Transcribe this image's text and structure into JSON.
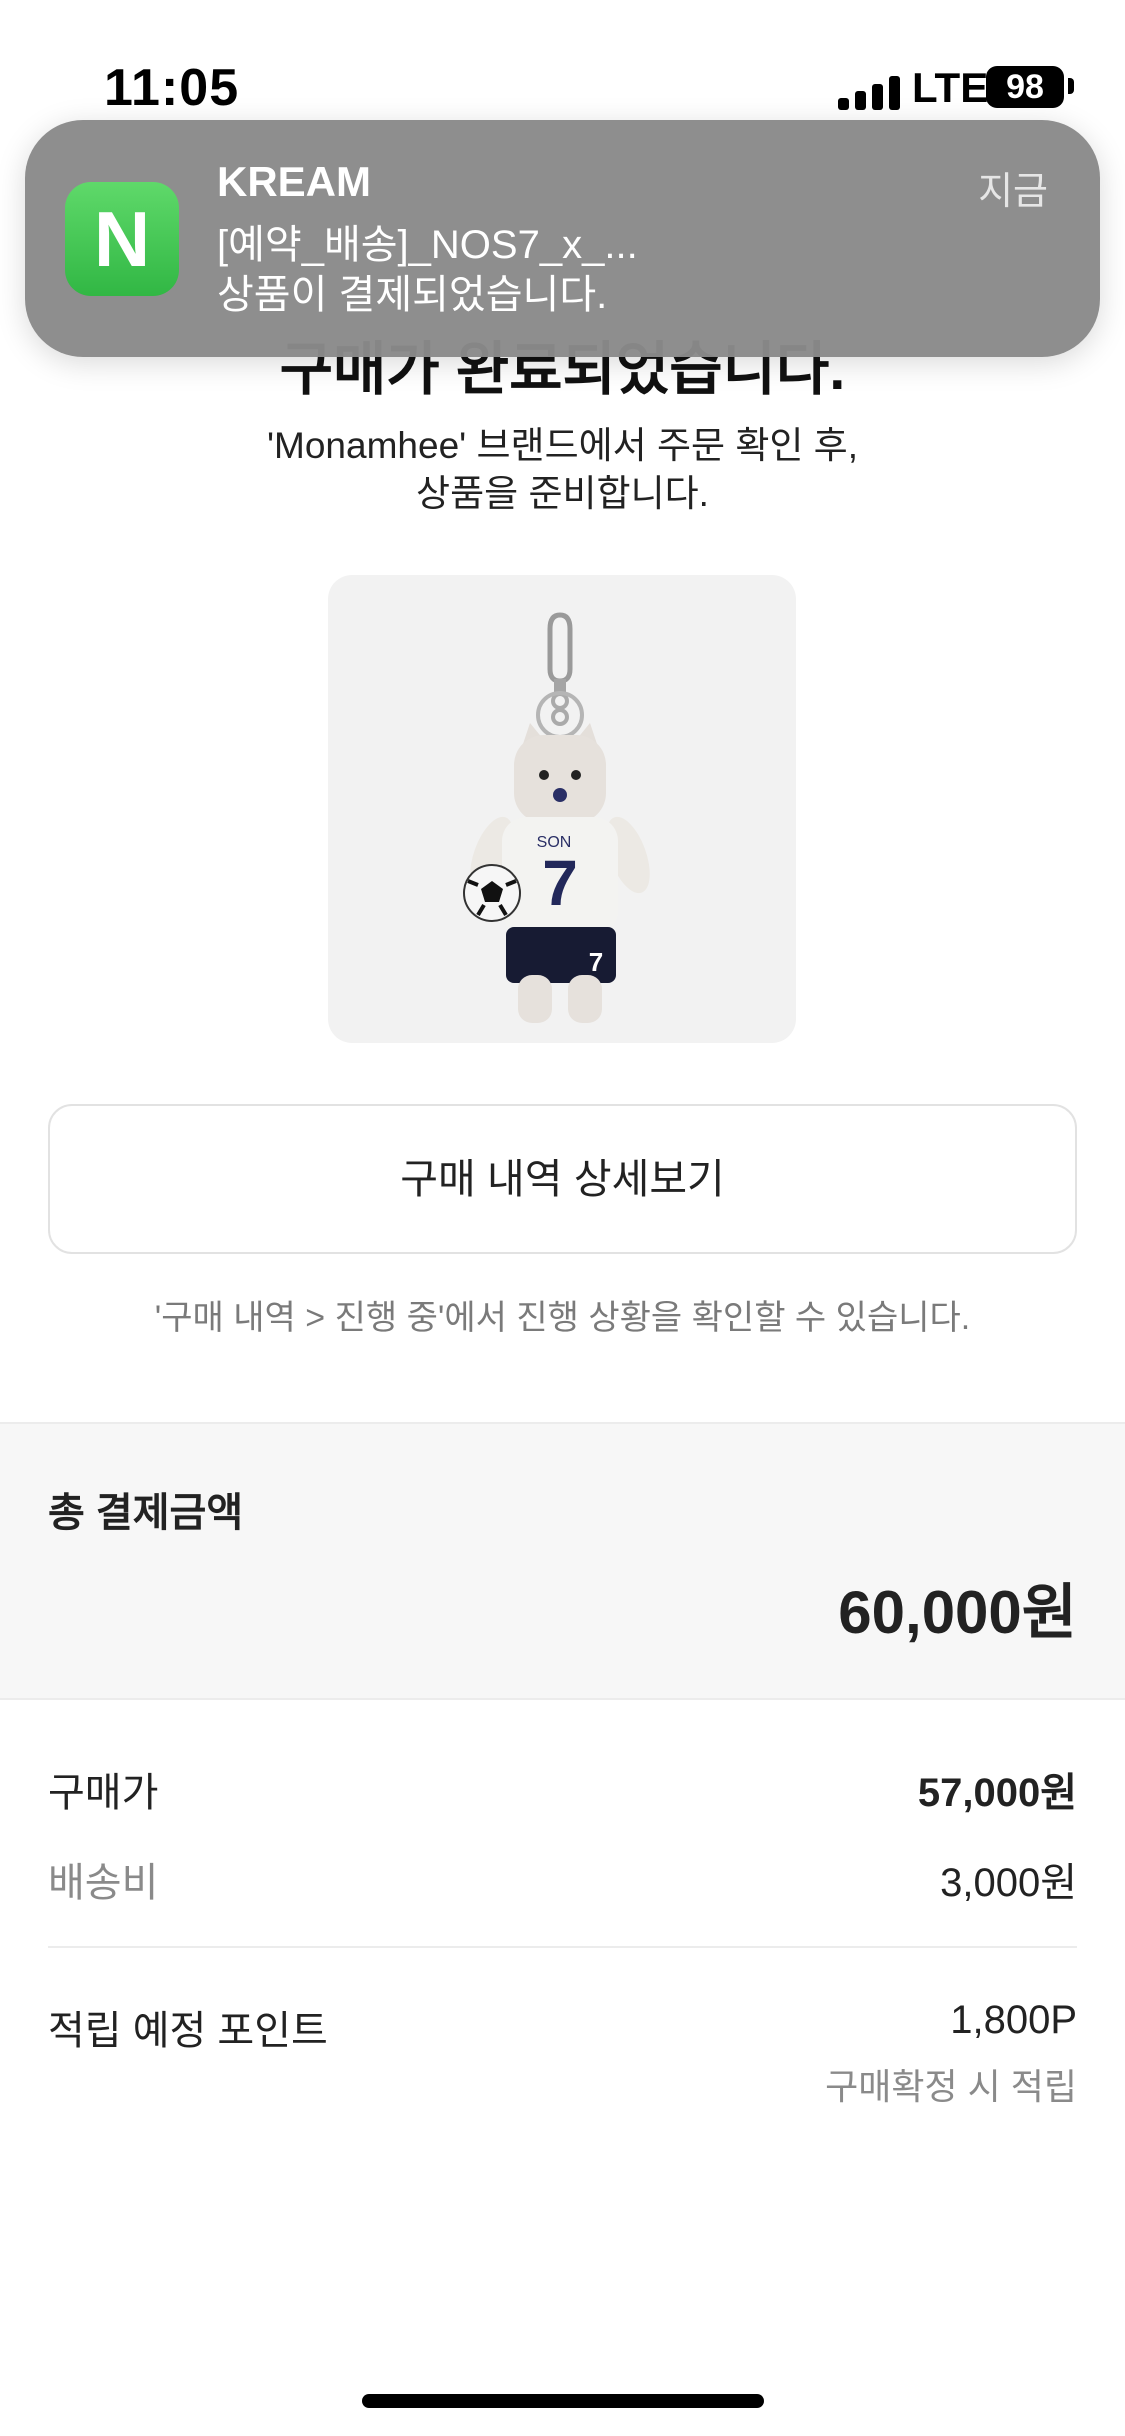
{
  "status_bar": {
    "time": "11:05",
    "network": "LTE",
    "battery": "98"
  },
  "notification": {
    "app_name": "KREAM",
    "icon_letter": "N",
    "line1": "[예약_배송]_NOS7_x_...",
    "line2": "상품이 결제되었습니다.",
    "time": "지금",
    "icon_color": "#3cc454"
  },
  "page": {
    "heading": "구매가 완료되었습니다.",
    "sub_line1": "'Monamhee' 브랜드에서 주문 확인 후,",
    "sub_line2": "상품을 준비합니다."
  },
  "product": {
    "jersey_name": "SON",
    "jersey_number": "7"
  },
  "detail_button_label": "구매 내역 상세보기",
  "hint": "'구매 내역 > 진행 중'에서 진행 상황을 확인할 수 있습니다.",
  "total": {
    "label": "총 결제금액",
    "value": "60,000원"
  },
  "breakdown": {
    "purchase_price_label": "구매가",
    "purchase_price_value": "57,000원",
    "shipping_label": "배송비",
    "shipping_value": "3,000원",
    "points_label": "적립 예정 포인트",
    "points_value": "1,800P",
    "points_note": "구매확정 시 적립"
  }
}
